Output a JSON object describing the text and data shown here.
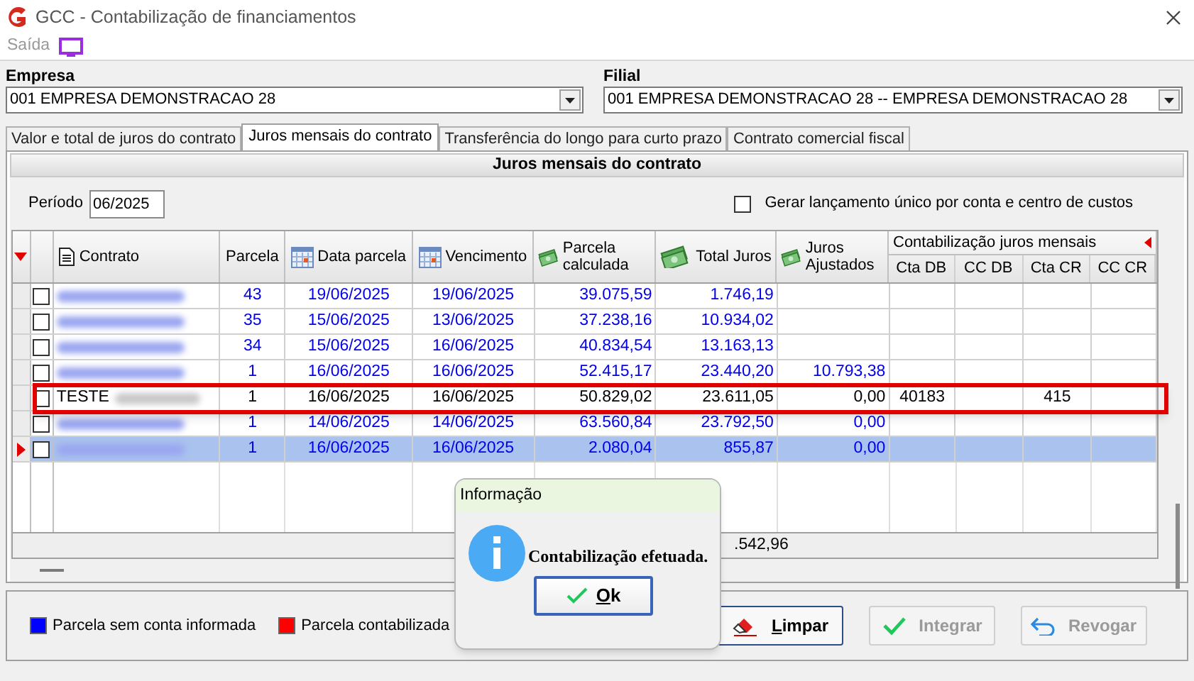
{
  "window": {
    "title": "GCC - Contabilização de financiamentos"
  },
  "menu": [
    {
      "label": "Saída"
    }
  ],
  "empresa": {
    "label": "Empresa",
    "value": "001 EMPRESA DEMONSTRACAO 28"
  },
  "filial": {
    "label": "Filial",
    "value": "001 EMPRESA DEMONSTRACAO 28 -- EMPRESA DEMONSTRACAO 28"
  },
  "tabs": [
    {
      "label": "Valor e total de juros do contrato",
      "selected": false
    },
    {
      "label": "Juros mensais do contrato",
      "selected": true
    },
    {
      "label": "Transferência do longo para curto prazo",
      "selected": false
    },
    {
      "label": "Contrato comercial fiscal",
      "selected": false
    }
  ],
  "panel_title": "Juros mensais do contrato",
  "periodo": {
    "label": "Período",
    "value": "06/2025"
  },
  "gerar_unico": {
    "label": "Gerar lançamento único por conta e centro de custos",
    "checked": false
  },
  "table": {
    "group_header": "Contabilização juros mensais",
    "columns": [
      "Contrato",
      "Parcela",
      "Data parcela",
      "Vencimento",
      "Parcela calculada",
      "Total Juros",
      "Juros Ajustados",
      "Cta DB",
      "CC DB",
      "Cta CR",
      "CC CR"
    ],
    "rows": [
      {
        "checked": false,
        "selected": false,
        "posted": false,
        "highlighted": false,
        "blurred": true,
        "cells": [
          null,
          "43",
          "19/06/2025",
          "19/06/2025",
          "39.075,59",
          "1.746,19",
          null,
          null,
          null,
          null,
          null
        ]
      },
      {
        "checked": false,
        "selected": false,
        "posted": false,
        "highlighted": false,
        "blurred": true,
        "cells": [
          null,
          "35",
          "15/06/2025",
          "13/06/2025",
          "37.238,16",
          "10.934,02",
          null,
          null,
          null,
          null,
          null
        ]
      },
      {
        "checked": false,
        "selected": false,
        "posted": false,
        "highlighted": false,
        "blurred": true,
        "cells": [
          null,
          "34",
          "15/06/2025",
          "16/06/2025",
          "40.834,54",
          "13.163,13",
          null,
          null,
          null,
          null,
          null
        ]
      },
      {
        "checked": false,
        "selected": false,
        "posted": false,
        "highlighted": false,
        "blurred": true,
        "cells": [
          null,
          "1",
          "16/06/2025",
          "16/06/2025",
          "52.415,17",
          "23.440,20",
          "10.793,38",
          null,
          null,
          null,
          null
        ]
      },
      {
        "checked": false,
        "selected": false,
        "posted": true,
        "highlighted": true,
        "blurred": true,
        "cells": [
          "TESTE",
          "1",
          "16/06/2025",
          "16/06/2025",
          "50.829,02",
          "23.611,05",
          "0,00",
          "40183",
          null,
          "415",
          null
        ]
      },
      {
        "checked": false,
        "selected": false,
        "posted": false,
        "highlighted": false,
        "blurred": true,
        "cells": [
          null,
          "1",
          "14/06/2025",
          "14/06/2025",
          "63.560,84",
          "23.792,50",
          "0,00",
          null,
          null,
          null,
          null
        ]
      },
      {
        "checked": false,
        "selected": true,
        "posted": false,
        "highlighted": false,
        "blurred": true,
        "cells": [
          null,
          "1",
          "16/06/2025",
          "16/06/2025",
          "2.080,04",
          "855,87",
          "0,00",
          null,
          null,
          null,
          null
        ]
      }
    ],
    "footer_total": ".542,96"
  },
  "legend": [
    {
      "label": "Parcela sem conta informada",
      "color": "#0000ff"
    },
    {
      "label": "Parcela contabilizada",
      "color": "#ff0000"
    }
  ],
  "buttons": [
    {
      "label": "Limpar",
      "disabled": false
    },
    {
      "label": "Integrar",
      "disabled": true
    },
    {
      "label": "Revogar",
      "disabled": true
    }
  ],
  "dialog": {
    "title": "Informação",
    "message": "Contabilização efetuada.",
    "button": "Ok"
  }
}
